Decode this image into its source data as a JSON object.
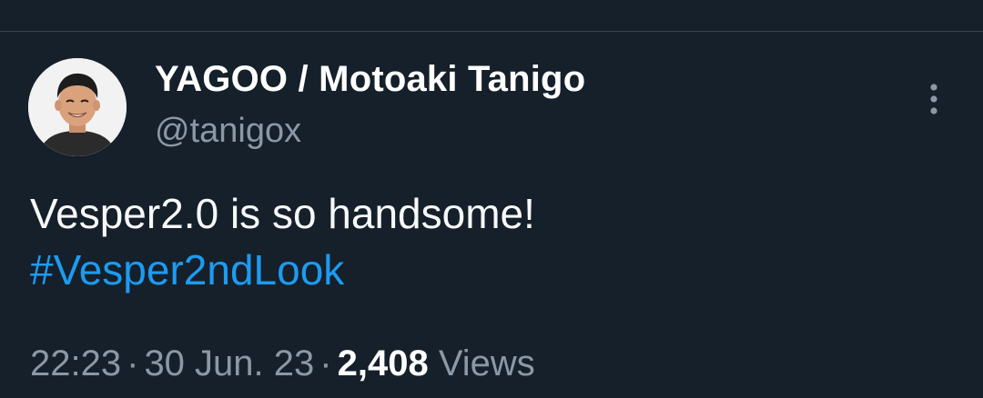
{
  "tweet": {
    "author": {
      "display_name": "YAGOO / Motoaki Tanigo",
      "handle": "@tanigox"
    },
    "text_line": "Vesper2.0 is so handsome!",
    "hashtag": "#Vesper2ndLook",
    "meta": {
      "time": "22:23",
      "separator": "·",
      "date": "30 Jun. 23",
      "view_count": "2,408",
      "views_label": "Views"
    }
  },
  "icons": {
    "more": "more-vertical-icon",
    "avatar": "profile-photo"
  },
  "colors": {
    "background": "#15202b",
    "divider": "#38444d",
    "primary_text": "#f7f9f9",
    "secondary_text": "#8b98a5",
    "link": "#1d9bf0"
  }
}
